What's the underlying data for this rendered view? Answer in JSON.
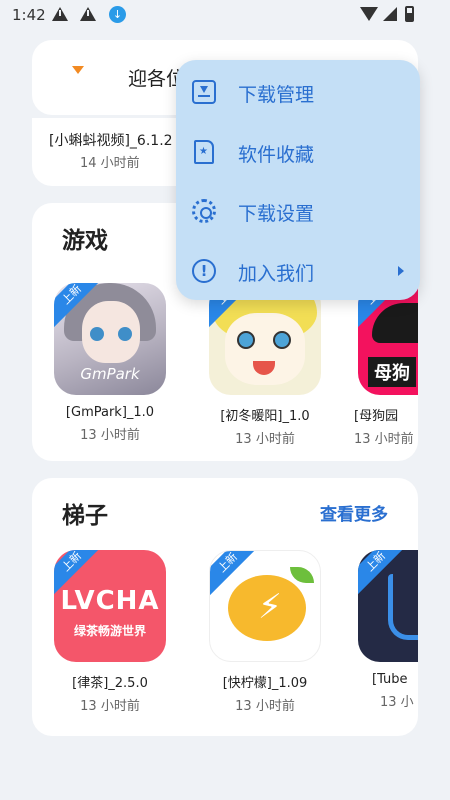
{
  "status_bar": {
    "time": "1:42",
    "icons": [
      "warning-icon",
      "warning-icon",
      "download-icon",
      "wifi-icon",
      "signal-icon",
      "battery-icon"
    ]
  },
  "header": {
    "welcome_text": "迎各位",
    "logo_icon": "app-logo-icon"
  },
  "recent": {
    "name": "[小蝌蚪视频]_6.1.2",
    "time": "14 小时前"
  },
  "games": {
    "title": "游戏",
    "apps": [
      {
        "name": "[GmPark]_1.0",
        "time": "13 小时前",
        "badge": "上新",
        "icon_text": "GmPark"
      },
      {
        "name": "[初冬暖阳]_1.0",
        "time": "13 小时前",
        "badge": "上新"
      },
      {
        "name": "[母狗园",
        "time": "13 小时前",
        "badge": "上新",
        "icon_text": "母狗"
      }
    ]
  },
  "ladder": {
    "title": "梯子",
    "more_label": "查看更多",
    "apps": [
      {
        "name": "[律茶]_2.5.0",
        "time": "13 小时前",
        "badge": "上新",
        "icon_text": "LVCHA",
        "icon_sub": "绿茶畅游世界"
      },
      {
        "name": "[快柠檬]_1.09",
        "time": "13 小时前",
        "badge": "上新"
      },
      {
        "name": "[Tube",
        "time": "13 小",
        "badge": "上新"
      }
    ]
  },
  "menu": {
    "items": [
      {
        "label": "下载管理",
        "icon": "download-box-icon"
      },
      {
        "label": "软件收藏",
        "icon": "favorite-file-icon"
      },
      {
        "label": "下载设置",
        "icon": "gear-icon"
      },
      {
        "label": "加入我们",
        "icon": "info-icon",
        "has_submenu": true
      }
    ]
  },
  "colors": {
    "accent": "#2a6fd0",
    "menu_bg": "#c4dff6",
    "badge": "#2a87e8",
    "background": "#eff2f6"
  }
}
